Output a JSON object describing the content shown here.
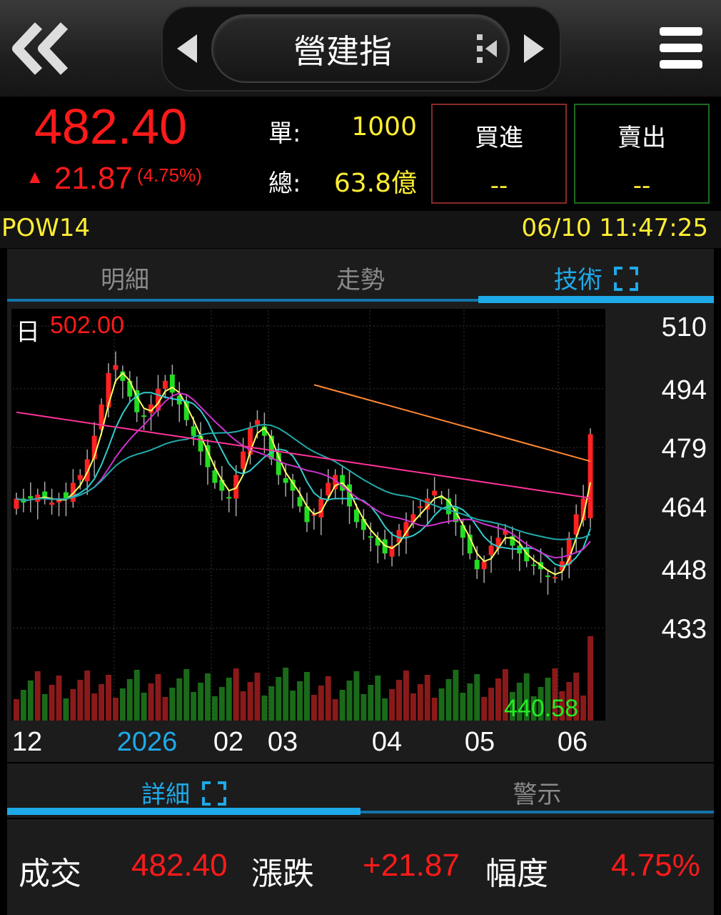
{
  "header": {
    "title": "營建指"
  },
  "quote": {
    "price": "482.40",
    "change": "21.87",
    "change_pct": "(4.75%)",
    "unit_label": "單:",
    "unit_value": "1000",
    "total_label": "總:",
    "total_value": "63.8億",
    "buy_label": "買進",
    "buy_value": "--",
    "sell_label": "賣出",
    "sell_value": "--"
  },
  "info": {
    "code": "POW14",
    "datetime": "06/10 11:47:25"
  },
  "tabs": [
    "明細",
    "走勢",
    "技術"
  ],
  "active_tab": "技術",
  "chart": {
    "period_label": "日",
    "high_label": "502.00",
    "low_label": "440.58",
    "y_ticks": [
      "510",
      "494",
      "479",
      "464",
      "448",
      "433"
    ],
    "x_ticks": [
      "12",
      "2026",
      "02",
      "03",
      "04",
      "05",
      "06"
    ]
  },
  "chart_data": {
    "type": "candlestick",
    "y_axis": {
      "ticks": [
        510,
        494,
        479,
        464,
        448,
        433
      ],
      "ylim": [
        433,
        510
      ]
    },
    "x_axis_labels": [
      "12",
      "2026",
      "02",
      "03",
      "04",
      "05",
      "06"
    ],
    "period": "日",
    "annotations": {
      "high": 502.0,
      "low": 440.58
    },
    "closes": [
      466,
      465,
      466,
      467,
      466,
      465,
      466,
      466,
      470,
      472,
      476,
      482,
      490,
      498,
      500,
      496,
      492,
      488,
      487,
      490,
      494,
      496,
      493,
      490,
      486,
      482,
      478,
      474,
      470,
      468,
      466,
      472,
      478,
      484,
      486,
      482,
      476,
      472,
      470,
      468,
      464,
      460,
      462,
      466,
      470,
      472,
      468,
      464,
      460,
      458,
      456,
      454,
      452,
      454,
      458,
      460,
      462,
      464,
      466,
      468,
      466,
      462,
      460,
      456,
      452,
      448,
      450,
      454,
      456,
      458,
      454,
      452,
      450,
      449,
      448,
      446,
      446,
      450,
      456,
      462,
      466,
      482.4
    ],
    "moving_averages": [
      {
        "color": "#ffff66",
        "period": "5"
      },
      {
        "color": "#33cccc",
        "period": "10"
      },
      {
        "color": "#cc33cc",
        "period": "20"
      },
      {
        "color": "#22aaaa",
        "period": "60"
      },
      {
        "color": "#ff3399",
        "period": "120"
      },
      {
        "color": "#ff8833",
        "period": "240"
      }
    ],
    "grid": true
  },
  "tabs2": [
    "詳細",
    "警示"
  ],
  "detail": {
    "trade_label": "成交",
    "trade_value": "482.40",
    "change_label": "漲跌",
    "change_value": "+21.87",
    "range_label": "幅度",
    "range_value": "4.75%"
  }
}
